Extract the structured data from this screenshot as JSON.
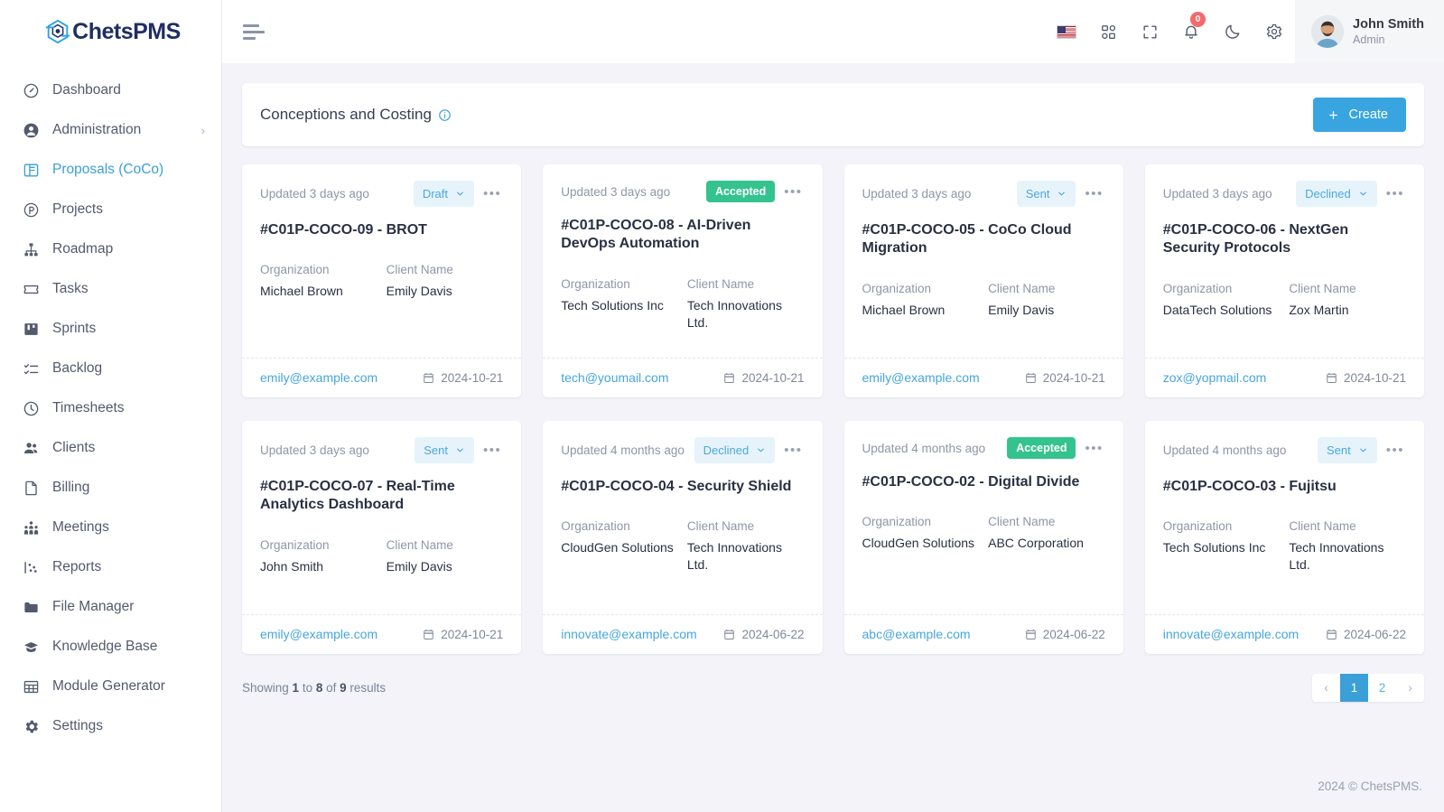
{
  "brand": {
    "name": "ChetsPMS",
    "accent": "#3b9fd8",
    "logo_icon": "chets-logo-icon"
  },
  "sidebar": {
    "items": [
      {
        "label": "Dashboard",
        "icon": "speedometer-icon",
        "active": false,
        "expandable": false
      },
      {
        "label": "Administration",
        "icon": "user-circle-icon",
        "active": false,
        "expandable": true
      },
      {
        "label": "Proposals (CoCo)",
        "icon": "layout-panel-icon",
        "active": true,
        "expandable": false
      },
      {
        "label": "Projects",
        "icon": "p-circle-icon",
        "active": false,
        "expandable": false
      },
      {
        "label": "Roadmap",
        "icon": "sitemap-icon",
        "active": false,
        "expandable": false
      },
      {
        "label": "Tasks",
        "icon": "ticket-icon",
        "active": false,
        "expandable": false
      },
      {
        "label": "Sprints",
        "icon": "kanban-icon",
        "active": false,
        "expandable": false
      },
      {
        "label": "Backlog",
        "icon": "checklist-icon",
        "active": false,
        "expandable": false
      },
      {
        "label": "Timesheets",
        "icon": "clock-icon",
        "active": false,
        "expandable": false
      },
      {
        "label": "Clients",
        "icon": "people-icon",
        "active": false,
        "expandable": false
      },
      {
        "label": "Billing",
        "icon": "file-icon",
        "active": false,
        "expandable": false
      },
      {
        "label": "Meetings",
        "icon": "group-icon",
        "active": false,
        "expandable": false
      },
      {
        "label": "Reports",
        "icon": "chart-scatter-icon",
        "active": false,
        "expandable": false
      },
      {
        "label": "File Manager",
        "icon": "folder-icon",
        "active": false,
        "expandable": false
      },
      {
        "label": "Knowledge Base",
        "icon": "graduation-cap-icon",
        "active": false,
        "expandable": false
      },
      {
        "label": "Module Generator",
        "icon": "grid-table-icon",
        "active": false,
        "expandable": false
      },
      {
        "label": "Settings",
        "icon": "gear-icon",
        "active": false,
        "expandable": false
      }
    ]
  },
  "topbar": {
    "menu_toggle_icon": "hamburger-icon",
    "icons": [
      {
        "name": "flag-us-icon",
        "title": "Language"
      },
      {
        "name": "apps-grid-icon",
        "title": "Apps"
      },
      {
        "name": "fullscreen-icon",
        "title": "Fullscreen"
      },
      {
        "name": "bell-icon",
        "title": "Notifications",
        "badge": "0"
      },
      {
        "name": "moon-icon",
        "title": "Dark mode"
      },
      {
        "name": "gear-icon",
        "title": "Settings"
      }
    ],
    "notification_count": "0",
    "user": {
      "name": "John Smith",
      "role": "Admin",
      "avatar": "user-avatar"
    }
  },
  "page": {
    "title": "Conceptions and Costing",
    "info_icon": "info-circle-icon",
    "create_label": "Create",
    "create_icon": "plus-icon"
  },
  "labels": {
    "organization": "Organization",
    "client_name": "Client Name",
    "more_icon": "ellipsis-icon",
    "calendar_icon": "calendar-icon",
    "chevron_down_icon": "chevron-down-icon"
  },
  "cards": [
    {
      "updated": "Updated 3 days ago",
      "status": "Draft",
      "status_type": "soft",
      "title": "#C01P-COCO-09 - BROT",
      "organization": "Michael Brown",
      "client_name": "Emily Davis",
      "email": "emily@example.com",
      "date": "2024-10-21"
    },
    {
      "updated": "Updated 3 days ago",
      "status": "Accepted",
      "status_type": "accepted",
      "title": "#C01P-COCO-08 - AI-Driven DevOps Automation",
      "organization": "Tech Solutions Inc",
      "client_name": "Tech Innovations Ltd.",
      "email": "tech@youmail.com",
      "date": "2024-10-21"
    },
    {
      "updated": "Updated 3 days ago",
      "status": "Sent",
      "status_type": "soft",
      "title": "#C01P-COCO-05 - CoCo Cloud Migration",
      "organization": "Michael Brown",
      "client_name": "Emily Davis",
      "email": "emily@example.com",
      "date": "2024-10-21"
    },
    {
      "updated": "Updated 3 days ago",
      "status": "Declined",
      "status_type": "soft",
      "title": "#C01P-COCO-06 - NextGen Security Protocols",
      "organization": "DataTech Solutions",
      "client_name": "Zox Martin",
      "email": "zox@yopmail.com",
      "date": "2024-10-21"
    },
    {
      "updated": "Updated 3 days ago",
      "status": "Sent",
      "status_type": "soft",
      "title": "#C01P-COCO-07 - Real-Time Analytics Dashboard",
      "organization": "John Smith",
      "client_name": "Emily Davis",
      "email": "emily@example.com",
      "date": "2024-10-21"
    },
    {
      "updated": "Updated 4 months ago",
      "status": "Declined",
      "status_type": "soft",
      "title": "#C01P-COCO-04 - Security Shield",
      "organization": "CloudGen Solutions",
      "client_name": "Tech Innovations Ltd.",
      "email": "innovate@example.com",
      "date": "2024-06-22"
    },
    {
      "updated": "Updated 4 months ago",
      "status": "Accepted",
      "status_type": "accepted",
      "title": "#C01P-COCO-02 - Digital Divide",
      "organization": "CloudGen Solutions",
      "client_name": "ABC Corporation",
      "email": "abc@example.com",
      "date": "2024-06-22"
    },
    {
      "updated": "Updated 4 months ago",
      "status": "Sent",
      "status_type": "soft",
      "title": "#C01P-COCO-03 - Fujitsu",
      "organization": "Tech Solutions Inc",
      "client_name": "Tech Innovations Ltd.",
      "email": "innovate@example.com",
      "date": "2024-06-22"
    }
  ],
  "pagination": {
    "showing_prefix": "Showing ",
    "from": "1",
    "showing_mid1": " to ",
    "to": "8",
    "showing_mid2": " of ",
    "total": "9",
    "showing_suffix": " results",
    "prev_label": "‹",
    "next_label": "›",
    "pages": [
      "1",
      "2"
    ],
    "active_page": "1"
  },
  "footer": {
    "text": "2024 © ChetsPMS."
  }
}
